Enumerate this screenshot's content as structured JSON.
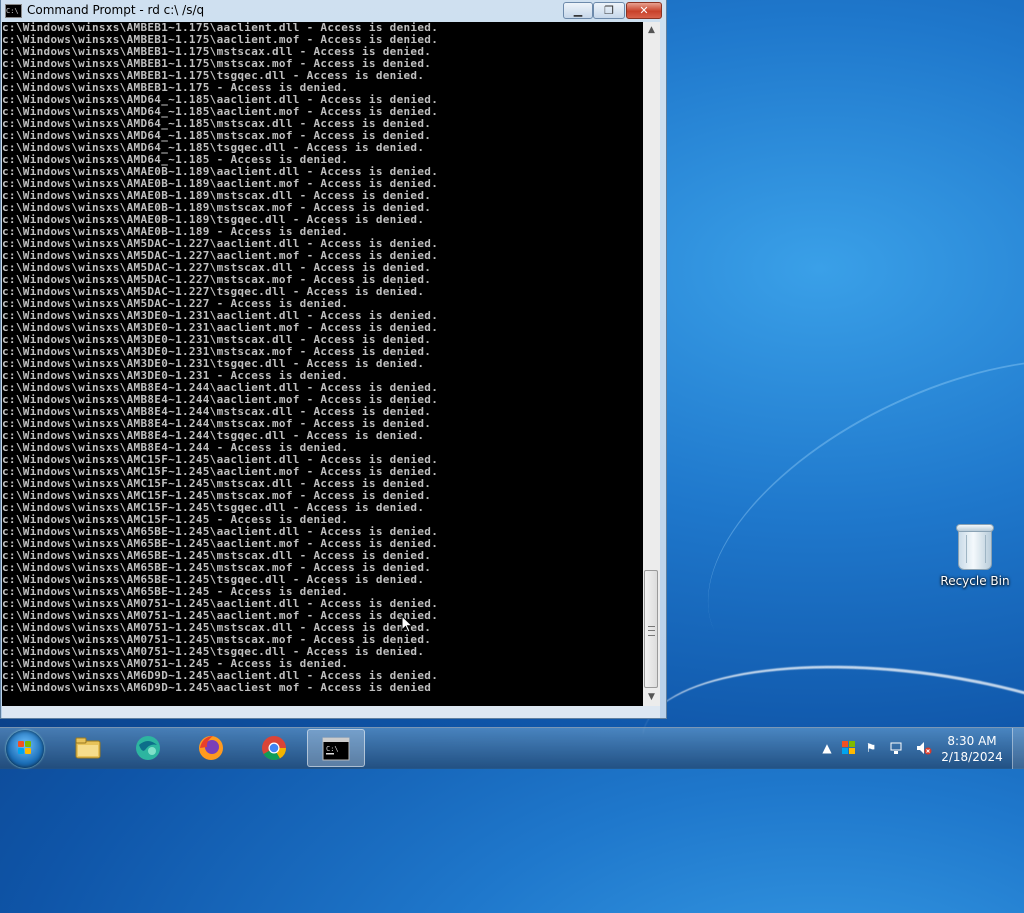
{
  "window": {
    "title": "Command Prompt - rd  c:\\ /s/q",
    "controls": {
      "minimize": "▁",
      "maximize": "❐",
      "close": "✕"
    }
  },
  "console": {
    "lines": [
      "c:\\Windows\\winsxs\\AMBEB1~1.175\\aaclient.dll - Access is denied.",
      "c:\\Windows\\winsxs\\AMBEB1~1.175\\aaclient.mof - Access is denied.",
      "c:\\Windows\\winsxs\\AMBEB1~1.175\\mstscax.dll - Access is denied.",
      "c:\\Windows\\winsxs\\AMBEB1~1.175\\mstscax.mof - Access is denied.",
      "c:\\Windows\\winsxs\\AMBEB1~1.175\\tsgqec.dll - Access is denied.",
      "c:\\Windows\\winsxs\\AMBEB1~1.175 - Access is denied.",
      "c:\\Windows\\winsxs\\AMD64_~1.185\\aaclient.dll - Access is denied.",
      "c:\\Windows\\winsxs\\AMD64_~1.185\\aaclient.mof - Access is denied.",
      "c:\\Windows\\winsxs\\AMD64_~1.185\\mstscax.dll - Access is denied.",
      "c:\\Windows\\winsxs\\AMD64_~1.185\\mstscax.mof - Access is denied.",
      "c:\\Windows\\winsxs\\AMD64_~1.185\\tsgqec.dll - Access is denied.",
      "c:\\Windows\\winsxs\\AMD64_~1.185 - Access is denied.",
      "c:\\Windows\\winsxs\\AMAE0B~1.189\\aaclient.dll - Access is denied.",
      "c:\\Windows\\winsxs\\AMAE0B~1.189\\aaclient.mof - Access is denied.",
      "c:\\Windows\\winsxs\\AMAE0B~1.189\\mstscax.dll - Access is denied.",
      "c:\\Windows\\winsxs\\AMAE0B~1.189\\mstscax.mof - Access is denied.",
      "c:\\Windows\\winsxs\\AMAE0B~1.189\\tsgqec.dll - Access is denied.",
      "c:\\Windows\\winsxs\\AMAE0B~1.189 - Access is denied.",
      "c:\\Windows\\winsxs\\AM5DAC~1.227\\aaclient.dll - Access is denied.",
      "c:\\Windows\\winsxs\\AM5DAC~1.227\\aaclient.mof - Access is denied.",
      "c:\\Windows\\winsxs\\AM5DAC~1.227\\mstscax.dll - Access is denied.",
      "c:\\Windows\\winsxs\\AM5DAC~1.227\\mstscax.mof - Access is denied.",
      "c:\\Windows\\winsxs\\AM5DAC~1.227\\tsgqec.dll - Access is denied.",
      "c:\\Windows\\winsxs\\AM5DAC~1.227 - Access is denied.",
      "c:\\Windows\\winsxs\\AM3DE0~1.231\\aaclient.dll - Access is denied.",
      "c:\\Windows\\winsxs\\AM3DE0~1.231\\aaclient.mof - Access is denied.",
      "c:\\Windows\\winsxs\\AM3DE0~1.231\\mstscax.dll - Access is denied.",
      "c:\\Windows\\winsxs\\AM3DE0~1.231\\mstscax.mof - Access is denied.",
      "c:\\Windows\\winsxs\\AM3DE0~1.231\\tsgqec.dll - Access is denied.",
      "c:\\Windows\\winsxs\\AM3DE0~1.231 - Access is denied.",
      "c:\\Windows\\winsxs\\AMB8E4~1.244\\aaclient.dll - Access is denied.",
      "c:\\Windows\\winsxs\\AMB8E4~1.244\\aaclient.mof - Access is denied.",
      "c:\\Windows\\winsxs\\AMB8E4~1.244\\mstscax.dll - Access is denied.",
      "c:\\Windows\\winsxs\\AMB8E4~1.244\\mstscax.mof - Access is denied.",
      "c:\\Windows\\winsxs\\AMB8E4~1.244\\tsgqec.dll - Access is denied.",
      "c:\\Windows\\winsxs\\AMB8E4~1.244 - Access is denied.",
      "c:\\Windows\\winsxs\\AMC15F~1.245\\aaclient.dll - Access is denied.",
      "c:\\Windows\\winsxs\\AMC15F~1.245\\aaclient.mof - Access is denied.",
      "c:\\Windows\\winsxs\\AMC15F~1.245\\mstscax.dll - Access is denied.",
      "c:\\Windows\\winsxs\\AMC15F~1.245\\mstscax.mof - Access is denied.",
      "c:\\Windows\\winsxs\\AMC15F~1.245\\tsgqec.dll - Access is denied.",
      "c:\\Windows\\winsxs\\AMC15F~1.245 - Access is denied.",
      "c:\\Windows\\winsxs\\AM65BE~1.245\\aaclient.dll - Access is denied.",
      "c:\\Windows\\winsxs\\AM65BE~1.245\\aaclient.mof - Access is denied.",
      "c:\\Windows\\winsxs\\AM65BE~1.245\\mstscax.dll - Access is denied.",
      "c:\\Windows\\winsxs\\AM65BE~1.245\\mstscax.mof - Access is denied.",
      "c:\\Windows\\winsxs\\AM65BE~1.245\\tsgqec.dll - Access is denied.",
      "c:\\Windows\\winsxs\\AM65BE~1.245 - Access is denied.",
      "c:\\Windows\\winsxs\\AM0751~1.245\\aaclient.dll - Access is denied.",
      "c:\\Windows\\winsxs\\AM0751~1.245\\aaclient.mof - Access is denied.",
      "c:\\Windows\\winsxs\\AM0751~1.245\\mstscax.dll - Access is denied.",
      "c:\\Windows\\winsxs\\AM0751~1.245\\mstscax.mof - Access is denied.",
      "c:\\Windows\\winsxs\\AM0751~1.245\\tsgqec.dll - Access is denied.",
      "c:\\Windows\\winsxs\\AM0751~1.245 - Access is denied.",
      "c:\\Windows\\winsxs\\AM6D9D~1.245\\aaclient.dll - Access is denied.",
      "c:\\Windows\\winsxs\\AM6D9D~1.245\\aacliest mof - Access is denied"
    ]
  },
  "desktop": {
    "recycle_bin_label": "Recycle Bin"
  },
  "taskbar": {
    "apps": [
      {
        "name": "explorer",
        "icon": "folder-icon"
      },
      {
        "name": "browser",
        "icon": "globe-icon"
      },
      {
        "name": "firefox",
        "icon": "firefox-icon"
      },
      {
        "name": "chrome",
        "icon": "chrome-icon"
      },
      {
        "name": "command-prompt",
        "icon": "cmd-icon",
        "active": true
      }
    ],
    "clock": {
      "time": "8:30 AM",
      "date": "2/18/2024"
    },
    "tray": [
      "show-hidden-icons-arrow",
      "action-center-flag",
      "network-icon",
      "volume-muted-icon"
    ]
  },
  "colors": {
    "console_bg": "#000000",
    "console_text": "#c0c0c0",
    "close_button": "#c8412a"
  }
}
